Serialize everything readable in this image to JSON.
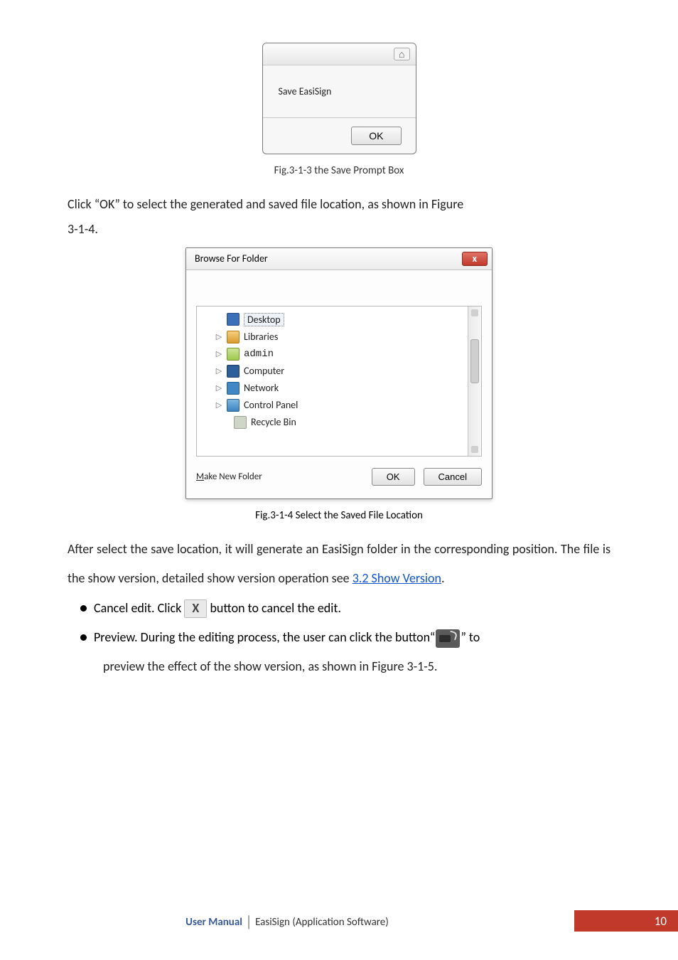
{
  "save_dialog": {
    "message": "Save EasiSign",
    "ok_label": "OK",
    "close_glyph": "⌂"
  },
  "captions": {
    "c313": "Fig.3-1-3 the Save Prompt Box",
    "c314": "Fig.3-1-4 Select the Saved File Location"
  },
  "para1a": "Click “OK” to select the generated and saved file location, as shown in Figure",
  "para1b": "3-1-4.",
  "browse_dialog": {
    "title": "Browse For Folder",
    "items": [
      {
        "tri": "",
        "ico": "ico-desktop",
        "label": "Desktop",
        "sel": true,
        "mono": false
      },
      {
        "tri": "▷",
        "ico": "ico-lib",
        "label": "Libraries",
        "sel": false,
        "mono": false
      },
      {
        "tri": "▷",
        "ico": "ico-user",
        "label": "admin",
        "sel": false,
        "mono": true
      },
      {
        "tri": "▷",
        "ico": "ico-comp",
        "label": "Computer",
        "sel": false,
        "mono": false
      },
      {
        "tri": "▷",
        "ico": "ico-net",
        "label": "Network",
        "sel": false,
        "mono": false
      },
      {
        "tri": "▷",
        "ico": "ico-cp",
        "label": "Control Panel",
        "sel": false,
        "mono": false
      },
      {
        "tri": "",
        "ico": "ico-bin",
        "label": "Recycle Bin",
        "sel": false,
        "mono": false
      }
    ],
    "make_folder": "Make New Folder",
    "ok": "OK",
    "cancel": "Cancel"
  },
  "para2": "After select the save location, it will generate an EasiSign folder in the corresponding position. The file is the show version, detailed show version operation see ",
  "para2_link": "3.2 Show Version",
  "para2_end": ".",
  "bullets": {
    "cancel_pre": "Cancel edit. Click ",
    "cancel_post": " button to cancel the edit.",
    "preview_pre": "Preview. During the editing process, the user can click the button“",
    "preview_post": "” to",
    "preview_line2": "preview the effect of the show version, as shown in Figure 3-1-5."
  },
  "footer": {
    "bold": "User Manual",
    "rest": "EasiSign (Application Software)",
    "page": "10"
  }
}
